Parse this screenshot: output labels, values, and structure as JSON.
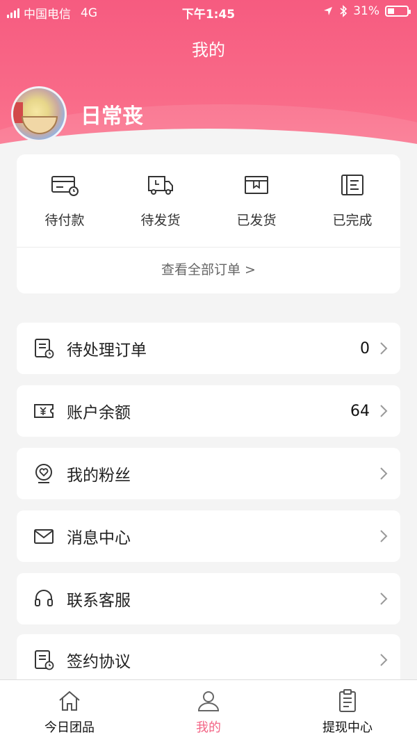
{
  "status_bar": {
    "carrier": "中国电信",
    "network": "4G",
    "time": "下午1:45",
    "battery": "31%",
    "battery_level": 0.31
  },
  "header": {
    "title": "我的"
  },
  "profile": {
    "username": "日常丧"
  },
  "orders": {
    "items": [
      {
        "label": "待付款",
        "icon": "card-clock-icon"
      },
      {
        "label": "待发货",
        "icon": "truck-icon"
      },
      {
        "label": "已发货",
        "icon": "box-icon"
      },
      {
        "label": "已完成",
        "icon": "list-doc-icon"
      }
    ],
    "view_all": "查看全部订单 >"
  },
  "menu": [
    {
      "label": "待处理订单",
      "value": "0",
      "icon": "pending-doc-icon"
    },
    {
      "label": "账户余额",
      "value": "64",
      "icon": "yen-ticket-icon"
    },
    {
      "label": "我的粉丝",
      "value": "",
      "icon": "fans-heart-icon"
    },
    {
      "label": "消息中心",
      "value": "",
      "icon": "mail-icon"
    },
    {
      "label": "联系客服",
      "value": "",
      "icon": "headset-icon"
    },
    {
      "label": "签约协议",
      "value": "",
      "icon": "contract-doc-icon"
    }
  ],
  "tabbar": {
    "items": [
      {
        "label": "今日团品",
        "icon": "home-icon",
        "active": false
      },
      {
        "label": "我的",
        "icon": "user-icon",
        "active": true
      },
      {
        "label": "提现中心",
        "icon": "clipboard-icon",
        "active": false
      }
    ]
  },
  "colors": {
    "accent": "#f36485",
    "header": "#f65b80",
    "background": "#f4f4f4"
  }
}
